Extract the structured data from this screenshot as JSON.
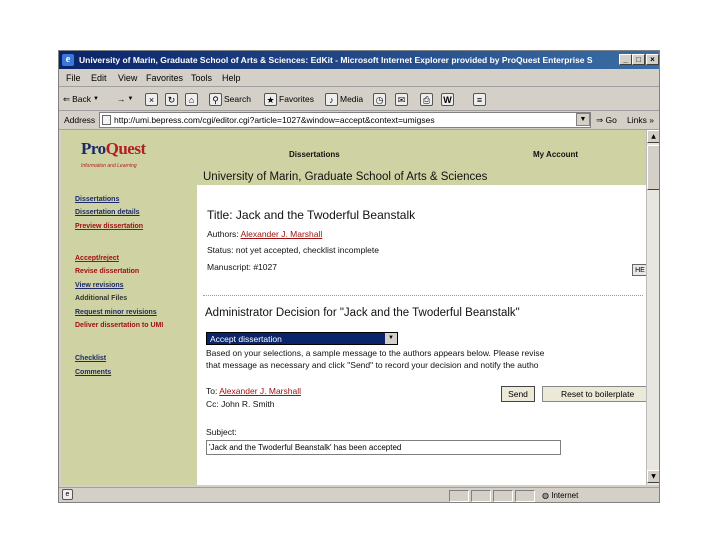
{
  "window": {
    "title": "University of Marin, Graduate School of Arts & Sciences: EdKit - Microsoft Internet Explorer provided by ProQuest Enterprise S",
    "min_label": "_",
    "max_label": "□",
    "close_label": "×"
  },
  "menu": [
    "File",
    "Edit",
    "View",
    "Favorites",
    "Tools",
    "Help"
  ],
  "toolbar": {
    "back_label": "Back",
    "forward_label": "→",
    "search_label": "Search",
    "favorites_label": "Favorites",
    "media_label": "Media"
  },
  "address": {
    "label": "Address",
    "url": "http://umi.bepress.com/cgi/editor.cgi?article=1027&window=accept&context=umigses",
    "go_label": "Go",
    "links_label": "Links »"
  },
  "header": {
    "logo_pro": "Pro",
    "logo_quest": "Quest",
    "tagline": "Information and Learning",
    "nav_dissertations": "Dissertations",
    "nav_my_account": "My Account",
    "school": "University of Marin, Graduate School of Arts & Sciences"
  },
  "sidebar": {
    "items": [
      {
        "label": "Dissertations"
      },
      {
        "label": "Dissertation details"
      },
      {
        "label": "Preview dissertation"
      },
      {
        "label": "Accept/reject"
      },
      {
        "label": "Revise dissertation"
      },
      {
        "label": "View revisions"
      },
      {
        "label": "Additional Files"
      },
      {
        "label": "Request minor revisions"
      },
      {
        "label": "Deliver dissertation to UMI"
      },
      {
        "label": "Checklist"
      },
      {
        "label": "Comments"
      }
    ]
  },
  "main": {
    "title": "Title: Jack and the Twoderful Beanstalk",
    "authors_label": "Authors:",
    "author_name": "Alexander J. Marshall",
    "status_label": "Status:",
    "status_value": "not yet accepted, checklist incomplete",
    "manuscript_label": "Manuscript:",
    "manuscript_value": "#1027",
    "hl_label": "HE",
    "decision_heading": "Administrator Decision for \"Jack and the Twoderful Beanstalk\"",
    "decision_value": "Accept dissertation",
    "message_line1": "Based on your selections, a sample message to the authors appears below. Please revise",
    "message_line2": "that message as necessary and click \"Send\" to record your decision and notify the autho",
    "to_label": "To:",
    "to_name": "Alexander J. Marshall",
    "cc_label": "Cc:",
    "cc_name": "John R. Smith",
    "send_label": "Send",
    "reset_label": "Reset to boilerplate",
    "subject_label": "Subject:",
    "subject_value": "'Jack and the Twoderful Beanstalk' has been accepted"
  },
  "statusbar": {
    "zone": "Internet"
  }
}
